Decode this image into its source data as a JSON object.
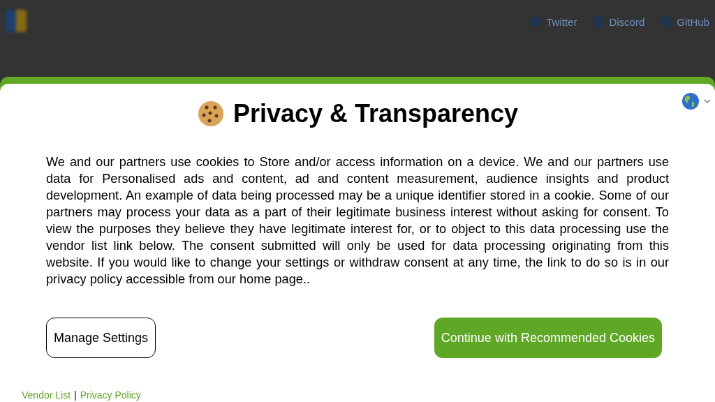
{
  "header": {
    "nav": [
      {
        "label": "Twitter",
        "kind": "bird"
      },
      {
        "label": "Discord",
        "kind": "chat"
      },
      {
        "label": "GitHub",
        "kind": "cat"
      }
    ]
  },
  "dialog": {
    "title": "Privacy & Transparency",
    "language_menu": {
      "expanded": false
    },
    "body": "We and our partners use cookies to Store and/or access information on a device. We and our partners use data for Personalised ads and content, ad and content measurement, audience insights and product development. An example of data being processed may be a unique identifier stored in a cookie. Some of our partners may process your data as a part of their legitimate business interest without asking for consent. To view the purposes they believe they have legitimate interest for, or to object to this data processing use the vendor list link below. The consent submitted will only be used for data processing originating from this website. If you would like to change your settings or withdraw consent at any time, the link to do so is in our privacy policy accessible from our home page..",
    "buttons": [
      {
        "label": "Manage Settings",
        "kind": "outline"
      },
      {
        "label": "Continue with Recommended Cookies",
        "kind": "primary"
      }
    ],
    "footer_links": [
      "Vendor List",
      "Privacy Policy"
    ],
    "footer_separator": "|"
  }
}
